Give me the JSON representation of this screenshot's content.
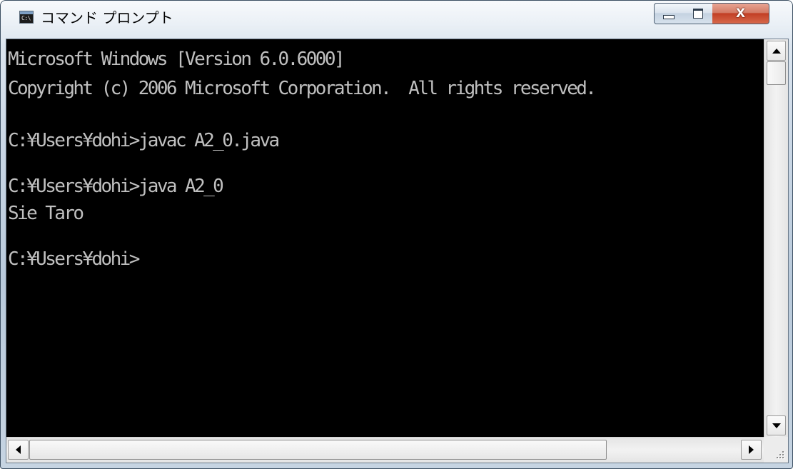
{
  "window": {
    "title": "コマンド プロンプト",
    "app_icon_text": "C:\\",
    "buttons": {
      "minimize": "minimize",
      "maximize": "maximize",
      "close": "X"
    }
  },
  "console": {
    "background": "#000000",
    "foreground": "#c0c0c0",
    "lines": [
      "Microsoft Windows [Version 6.0.6000]",
      "Copyright (c) 2006 Microsoft Corporation.  All rights reserved.",
      "",
      "C:¥Users¥dohi>javac A2_0.java",
      "",
      "C:¥Users¥dohi>java A2_0",
      "Sie Taro",
      "",
      "C:¥Users¥dohi>"
    ]
  },
  "icons": {
    "app": "console-app-icon",
    "minimize": "minimize-icon",
    "maximize": "maximize-icon",
    "close": "close-icon",
    "scroll_up": "arrow-up-icon",
    "scroll_down": "arrow-down-icon",
    "scroll_left": "arrow-left-icon",
    "scroll_right": "arrow-right-icon",
    "resize": "resize-grip-icon"
  },
  "colors": {
    "close_button": "#c23f25",
    "frame": "#cbd8e6"
  }
}
